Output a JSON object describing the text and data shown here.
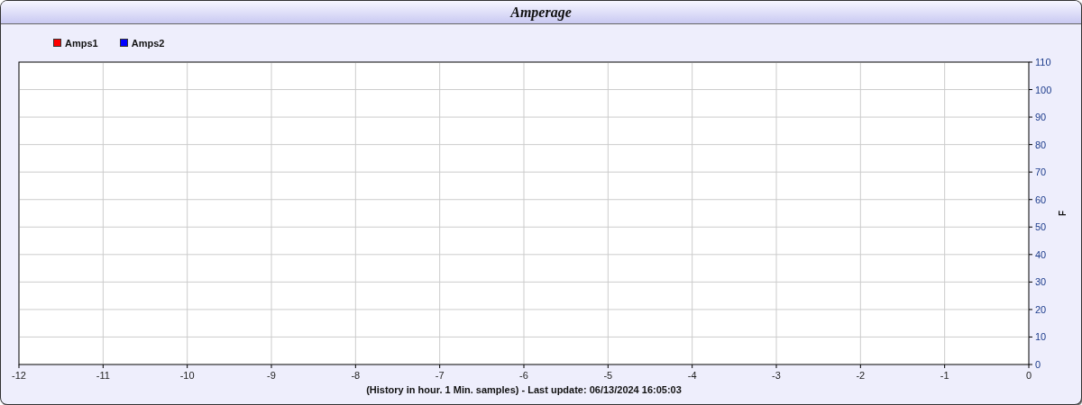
{
  "window": {
    "title": "Amperage"
  },
  "chart": {
    "chart_data": {
      "type": "line",
      "ylabel": "F",
      "xlabel": "(History in hour. 1 Min. samples) - Last update: 06/13/2024 16:05:03",
      "grid": true,
      "x": [
        -12,
        -11,
        -10,
        -9,
        -8,
        -7,
        -6,
        -5,
        -4,
        -3,
        -2,
        -1,
        0
      ],
      "series": [
        {
          "name": "Amps1",
          "color": "#ff0000",
          "values": [
            null,
            null,
            null,
            null,
            null,
            null,
            null,
            null,
            null,
            null,
            null,
            null,
            null
          ]
        },
        {
          "name": "Amps2",
          "color": "#0000ff",
          "values": [
            null,
            null,
            null,
            null,
            null,
            null,
            null,
            null,
            null,
            null,
            null,
            null,
            null
          ]
        }
      ],
      "ylim": [
        0,
        110
      ],
      "yticks": [
        0,
        10,
        20,
        30,
        40,
        50,
        60,
        70,
        80,
        90,
        100,
        110
      ]
    }
  }
}
